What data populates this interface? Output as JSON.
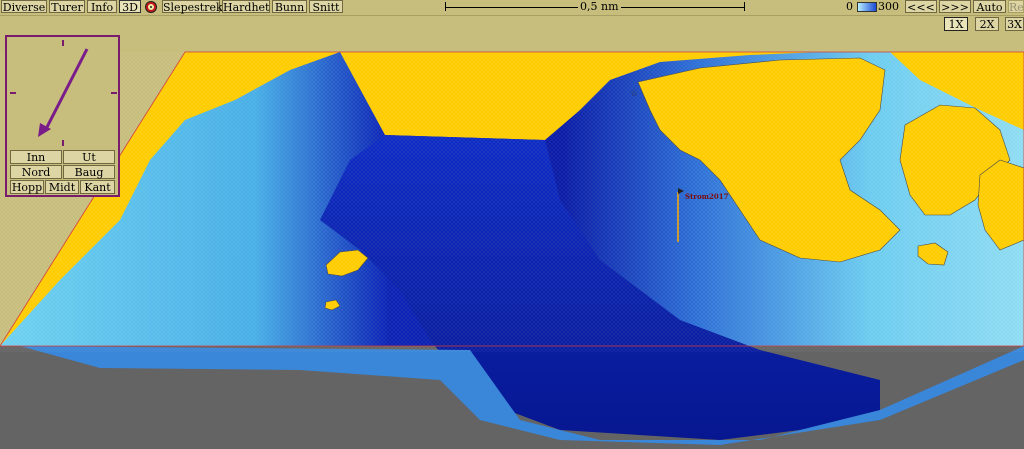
{
  "toolbar": {
    "items": [
      "Diverse",
      "Turer",
      "Info",
      "3D",
      "Slepestrek",
      "Hardhet",
      "Bunn",
      "Snitt"
    ],
    "scale_label": "0,5 nm",
    "depth_min": "0",
    "depth_max": "300",
    "nav_prev": "<<<",
    "nav_next": ">>>",
    "auto_label": "Auto",
    "re_label": "Re"
  },
  "zoom": {
    "levels": [
      "1X",
      "2X",
      "3X"
    ],
    "active": "1X"
  },
  "compass": {
    "buttons": [
      "Inn",
      "Ut",
      "Nord",
      "Baug",
      "Hopp",
      "Midt",
      "Kant"
    ],
    "arrow_color": "#7a1c8a"
  },
  "map": {
    "marker_label": "Strom2017",
    "colors": {
      "land": "#ffcc00",
      "shallow": "#7fd6f0",
      "deep": "#0a1fa8",
      "bed": "#646464",
      "frame": "#c7bd7c",
      "outline": "#d23c3c"
    }
  }
}
